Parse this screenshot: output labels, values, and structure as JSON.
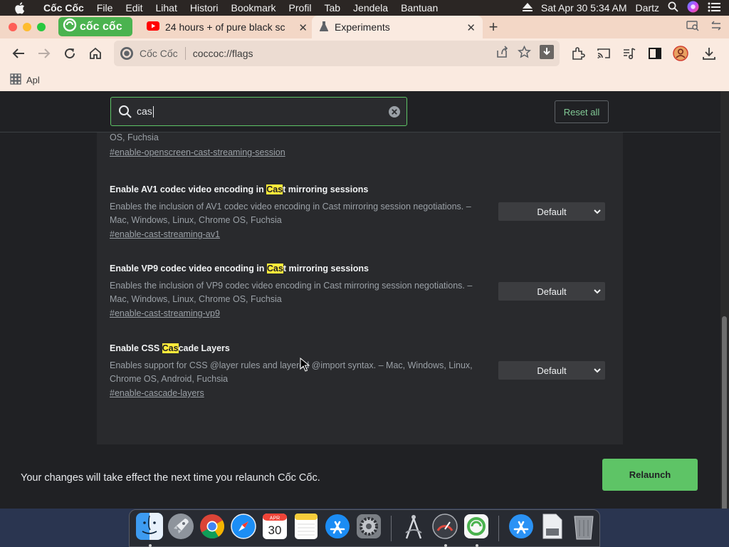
{
  "menubar": {
    "app_name": "Cốc Cốc",
    "items": [
      "File",
      "Edit",
      "Lihat",
      "Histori",
      "Bookmark",
      "Profil",
      "Tab",
      "Jendela",
      "Bantuan"
    ],
    "datetime": "Sat Apr 30  5:34 AM",
    "user": "Dartz"
  },
  "tabs": {
    "brand_label": "cốc cốc",
    "youtube_title": "24 hours + of pure black sc",
    "active_title": "Experiments",
    "close_glyph": "✕",
    "new_tab_glyph": "+"
  },
  "omnibox": {
    "site_name": "Cốc Cốc",
    "url": "coccoc://flags"
  },
  "bookmarks": {
    "apps_label": "Apl"
  },
  "search": {
    "query": "cas",
    "reset_label": "Reset all"
  },
  "partial_flag": {
    "desc_tail": "OS, Fuchsia",
    "link": "#enable-openscreen-cast-streaming-session"
  },
  "flags": [
    {
      "title_pre": "Enable AV1 codec video encoding in ",
      "title_hl": "Cas",
      "title_post": "t mirroring sessions",
      "desc": "Enables the inclusion of AV1 codec video encoding in Cast mirroring session negotiations. – Mac, Windows, Linux, Chrome OS, Fuchsia",
      "link": "#enable-cast-streaming-av1",
      "value": "Default"
    },
    {
      "title_pre": "Enable VP9 codec video encoding in ",
      "title_hl": "Cas",
      "title_post": "t mirroring sessions",
      "desc": "Enables the inclusion of VP9 codec video encoding in Cast mirroring session negotiations. – Mac, Windows, Linux, Chrome OS, Fuchsia",
      "link": "#enable-cast-streaming-vp9",
      "value": "Default"
    },
    {
      "title_pre": "Enable CSS ",
      "title_hl": "Cas",
      "title_post": "cade Layers",
      "desc": "Enables support for CSS @layer rules and layered @import syntax. – Mac, Windows, Linux, Chrome OS, Android, Fuchsia",
      "link": "#enable-cascade-layers",
      "value": "Default"
    }
  ],
  "relaunch": {
    "message": "Your changes will take effect the next time you relaunch Cốc Cốc.",
    "button": "Relaunch"
  },
  "dock": {
    "calendar_month": "APR",
    "calendar_day": "30"
  },
  "colors": {
    "accent_green": "#5ec466",
    "highlight_yellow": "#ffeb3b",
    "tabbar_bg": "#f3d7c6",
    "page_bg": "#202124"
  }
}
